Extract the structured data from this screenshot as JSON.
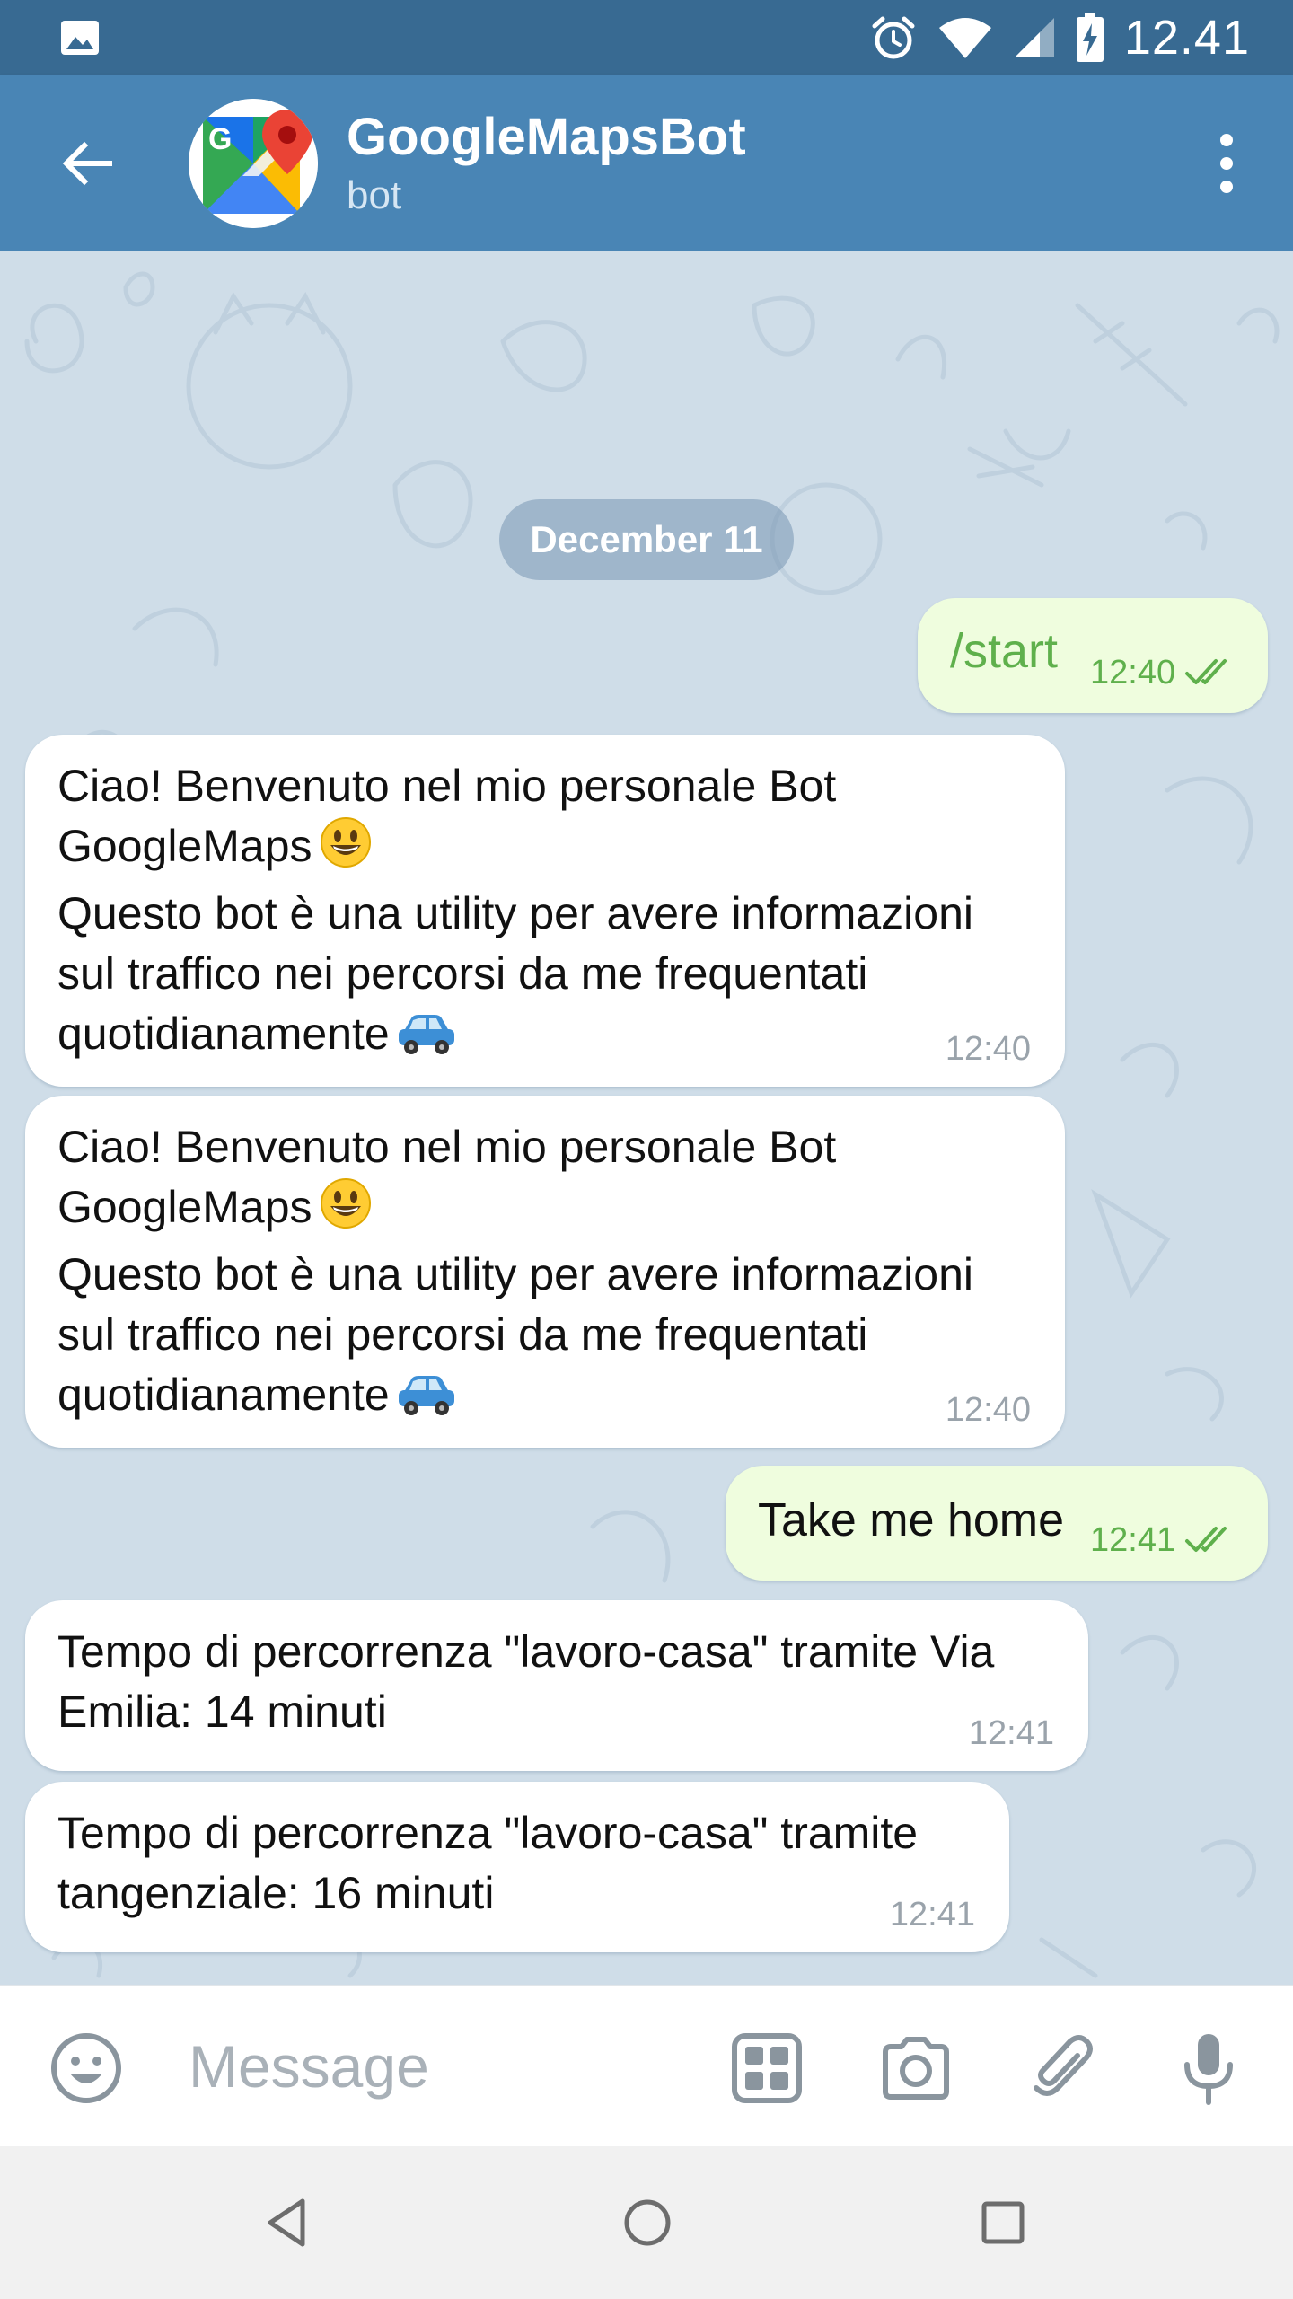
{
  "status_bar": {
    "time": "12.41",
    "icons": [
      "image-icon",
      "alarm-icon",
      "wifi-icon",
      "signal-icon",
      "battery-charging-icon"
    ]
  },
  "header": {
    "title": "GoogleMapsBot",
    "subtitle": "bot",
    "back_icon": "arrow-left-icon",
    "menu_icon": "more-vertical-icon",
    "avatar": "google-maps-logo"
  },
  "chat": {
    "date_label": "December 11",
    "messages": [
      {
        "direction": "out",
        "text": "/start",
        "time": "12:40",
        "status": "read"
      },
      {
        "direction": "in",
        "line1": "Ciao! Benvenuto nel mio personale Bot",
        "line2": "GoogleMaps",
        "line3": "Questo bot è una utility per avere informazioni",
        "line4": "sul traffico nei percorsi da me frequentati",
        "line5": "quotidianamente",
        "time": "12:40"
      },
      {
        "direction": "in",
        "line1": "Ciao! Benvenuto nel mio personale Bot",
        "line2": "GoogleMaps",
        "line3": "Questo bot è una utility per avere informazioni",
        "line4": "sul traffico nei percorsi da me frequentati",
        "line5": "quotidianamente",
        "time": "12:40"
      },
      {
        "direction": "out",
        "text": "Take me home",
        "time": "12:41",
        "status": "read"
      },
      {
        "direction": "in",
        "line1": "Tempo di percorrenza \"lavoro-casa\" tramite Via",
        "line2": "Emilia: 14 minuti",
        "time": "12:41"
      },
      {
        "direction": "in",
        "line1": "Tempo di percorrenza \"lavoro-casa\" tramite",
        "line2": "tangenziale: 16 minuti",
        "time": "12:41"
      }
    ]
  },
  "input_bar": {
    "placeholder": "Message",
    "value": "",
    "icons": [
      "emoji-icon",
      "bot-keyboard-icon",
      "camera-icon",
      "attach-icon",
      "mic-icon"
    ]
  },
  "nav_bar": {
    "icons": [
      "nav-back-icon",
      "nav-home-icon",
      "nav-recents-icon"
    ]
  },
  "colors": {
    "status_bar": "#386a92",
    "header": "#4985b5",
    "chat_background": "#cfdde8",
    "outgoing_bubble": "#effdde",
    "outgoing_accent": "#5fb04c",
    "incoming_bubble": "#ffffff"
  }
}
